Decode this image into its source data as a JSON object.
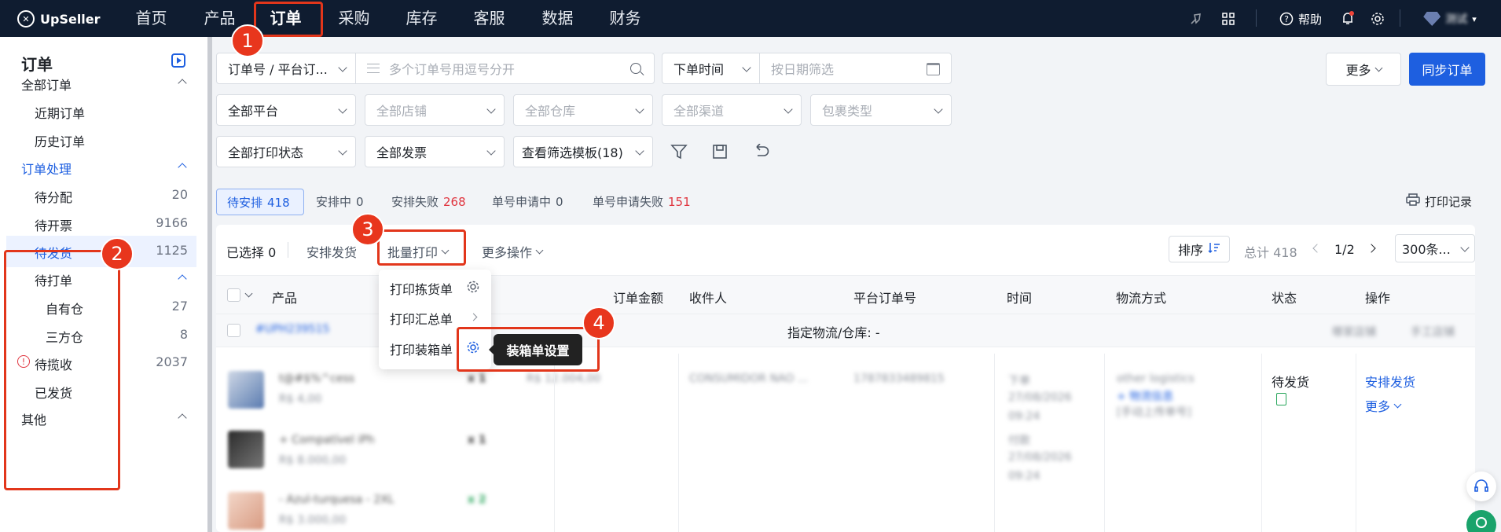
{
  "app": {
    "brand": "UpSeller"
  },
  "nav": [
    "首页",
    "产品",
    "订单",
    "采购",
    "库存",
    "客服",
    "数据",
    "财务"
  ],
  "topbar": {
    "help_label": "帮助",
    "user_name": "测试"
  },
  "sidebar": {
    "title": "订单",
    "groups": [
      {
        "label": "全部订单",
        "items": [
          {
            "label": "近期订单"
          },
          {
            "label": "历史订单"
          }
        ]
      },
      {
        "label": "订单处理",
        "items": [
          {
            "label": "待分配",
            "count": "20"
          },
          {
            "label": "待开票",
            "count": "9166"
          },
          {
            "label": "待发货",
            "count": "1125"
          },
          {
            "label": "待打单"
          },
          {
            "label": "自有仓",
            "count": "27"
          },
          {
            "label": "三方仓",
            "count": "8"
          },
          {
            "label": "待揽收",
            "count": "2037"
          },
          {
            "label": "已发货"
          }
        ]
      },
      {
        "label": "其他"
      }
    ]
  },
  "filters": {
    "order_type": "订单号 / 平台订...",
    "order_placeholder": "多个订单号用逗号分开",
    "time_type": "下单时间",
    "date_placeholder": "按日期筛选",
    "platform": "全部平台",
    "store": "全部店铺",
    "warehouse": "全部仓库",
    "channel": "全部渠道",
    "package": "包裹类型",
    "print_status": "全部打印状态",
    "invoice": "全部发票",
    "template": "查看筛选模板(18)"
  },
  "actions": {
    "more": "更多",
    "sync": "同步订单",
    "print_log": "打印记录"
  },
  "tabs": [
    {
      "label": "待安排",
      "count": "418"
    },
    {
      "label": "安排中",
      "count": "0"
    },
    {
      "label": "安排失败",
      "count": "268"
    },
    {
      "label": "单号申请中",
      "count": "0"
    },
    {
      "label": "单号申请失败",
      "count": "151"
    }
  ],
  "toolbar": {
    "selected_label": "已选择",
    "selected_count": "0",
    "arrange": "安排发货",
    "batch_print": "批量打印",
    "more_ops": "更多操作",
    "sort": "排序",
    "total": "总计 418",
    "page": "1/2",
    "page_size": "300条..."
  },
  "print_menu": [
    "打印拣货单",
    "打印汇总单",
    "打印装箱单"
  ],
  "tooltip": "装箱单设置",
  "table": {
    "headers": [
      "产品",
      "订单金额",
      "收件人",
      "平台订单号",
      "时间",
      "物流方式",
      "状态",
      "操作"
    ],
    "group": {
      "order_id": "#UPH239515",
      "warehouse": "指定物流/仓库: -",
      "store": "哪家店铺",
      "manual": "手工店铺"
    },
    "products": [
      {
        "name": "t@#$%^cess",
        "price": "R$ 4,00",
        "qty": "x 1"
      },
      {
        "name": "+ Compatível iPh",
        "price": "R$ 8.000,00",
        "qty": "x 1"
      },
      {
        "name": "- Azul-turquesa - 2XL",
        "price": "R$ 3.000,00",
        "qty": "x 2"
      }
    ],
    "amount": "R$ 12.004,00",
    "recipient": "CONSUMIDOR NAO ...",
    "platform_no": "1787833489815",
    "time_lines": [
      "下单",
      "27/08/2026",
      "09:24",
      "付款",
      "27/08/2026",
      "09:24"
    ],
    "logistics": {
      "name": "other logistics",
      "link": "+ 物流信息",
      "note": "[手动上传单号]"
    },
    "status": "待发货",
    "op_arrange": "安排发货",
    "op_more": "更多"
  },
  "annotations": [
    "1",
    "2",
    "3",
    "4"
  ],
  "colors": {
    "accent": "#1e5fe0",
    "annotation": "#e2361b",
    "topbar": "#0f1c30"
  }
}
